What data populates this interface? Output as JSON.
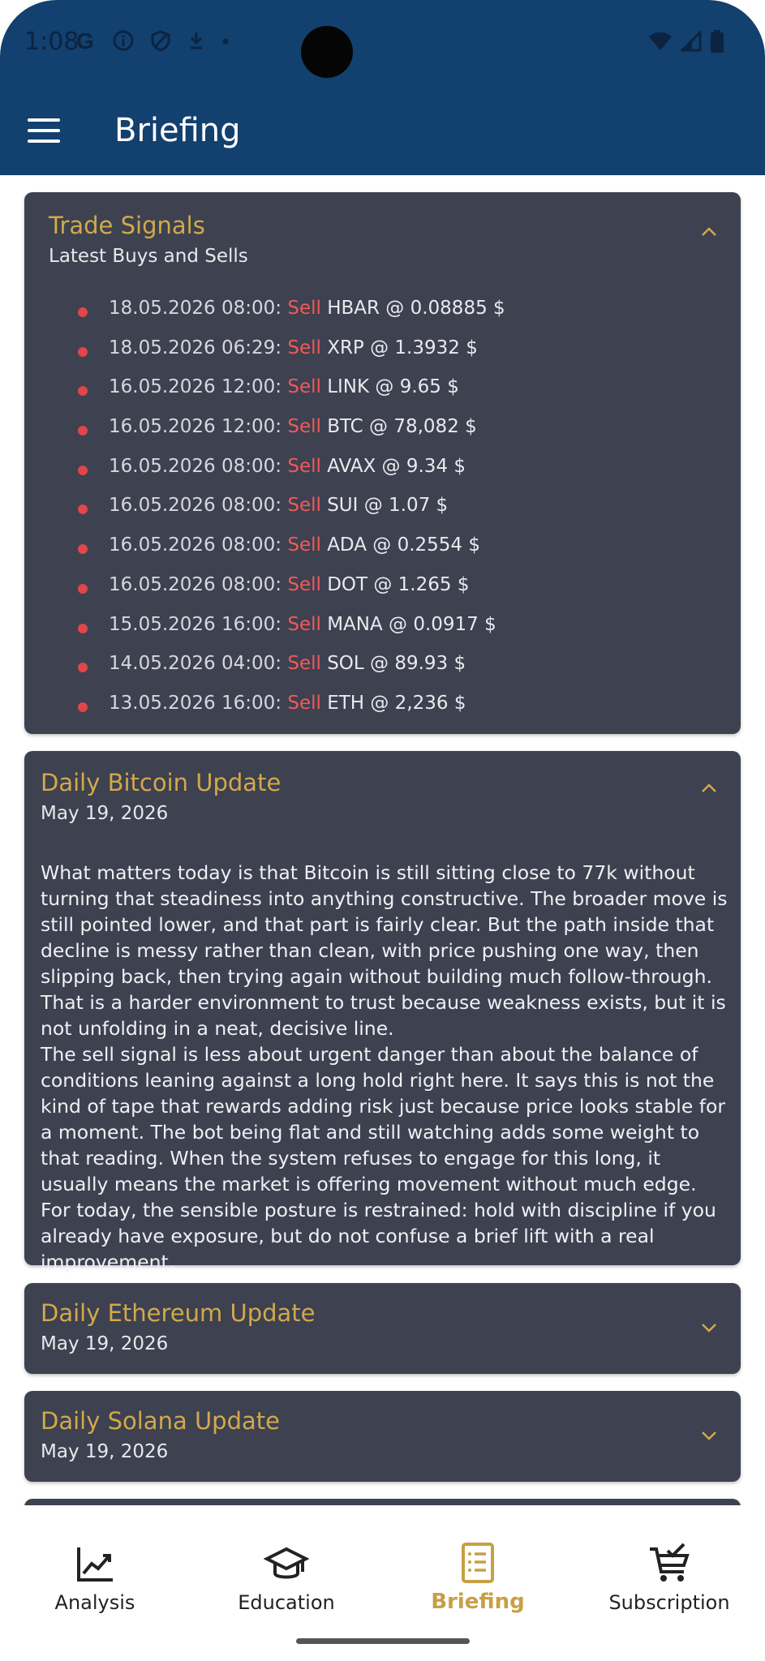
{
  "status_bar": {
    "time": "1:08",
    "icons_left": [
      "google-icon",
      "info-icon",
      "shield-icon",
      "download-icon",
      "dot-icon"
    ],
    "icons_right": [
      "wifi-icon",
      "signal-icon",
      "battery-icon"
    ]
  },
  "header": {
    "title": "Briefing"
  },
  "trade_signals": {
    "title": "Trade Signals",
    "subtitle": "Latest Buys and Sells",
    "expanded": true,
    "items": [
      {
        "datetime": "18.05.2026 08:00:",
        "action": "Sell",
        "detail": "HBAR @ 0.08885 $"
      },
      {
        "datetime": "18.05.2026 06:29:",
        "action": "Sell",
        "detail": "XRP @ 1.3932 $"
      },
      {
        "datetime": "16.05.2026 12:00:",
        "action": "Sell",
        "detail": "LINK @ 9.65 $"
      },
      {
        "datetime": "16.05.2026 12:00:",
        "action": "Sell",
        "detail": "BTC @ 78,082 $"
      },
      {
        "datetime": "16.05.2026 08:00:",
        "action": "Sell",
        "detail": "AVAX @ 9.34 $"
      },
      {
        "datetime": "16.05.2026 08:00:",
        "action": "Sell",
        "detail": "SUI @ 1.07 $"
      },
      {
        "datetime": "16.05.2026 08:00:",
        "action": "Sell",
        "detail": "ADA @ 0.2554 $"
      },
      {
        "datetime": "16.05.2026 08:00:",
        "action": "Sell",
        "detail": "DOT @ 1.265 $"
      },
      {
        "datetime": "15.05.2026 16:00:",
        "action": "Sell",
        "detail": "MANA @ 0.0917 $"
      },
      {
        "datetime": "14.05.2026 04:00:",
        "action": "Sell",
        "detail": "SOL @ 89.93 $"
      },
      {
        "datetime": "13.05.2026 16:00:",
        "action": "Sell",
        "detail": "ETH @ 2,236 $"
      }
    ]
  },
  "bitcoin_update": {
    "title": "Daily Bitcoin Update",
    "date": "May 19, 2026",
    "expanded": true,
    "paragraphs": [
      "What matters today is that Bitcoin is still sitting close to 77k without turning that steadiness into anything constructive. The broader move is still pointed lower, and that part is fairly clear. But the path inside that decline is messy rather than clean, with price pushing one way, then slipping back, then trying again without building much follow-through. That is a harder environment to trust because weakness exists, but it is not unfolding in a neat, decisive line.",
      "The sell signal is less about urgent danger than about the balance of conditions leaning against a long hold right here. It says this is not the kind of tape that rewards adding risk just because price looks stable for a moment. The bot being flat and still watching adds some weight to that reading. When the system refuses to engage for this long, it usually means the market is offering movement without much edge. For today, the sensible posture is restrained: hold with discipline if you already have exposure, but do not confuse a brief lift with a real improvement."
    ]
  },
  "ethereum_update": {
    "title": "Daily Ethereum Update",
    "date": "May 19, 2026",
    "expanded": false
  },
  "solana_update": {
    "title": "Daily Solana Update",
    "date": "May 19, 2026",
    "expanded": false
  },
  "bottom_nav": {
    "items": [
      {
        "label": "Analysis",
        "icon": "chart-line-icon",
        "active": false
      },
      {
        "label": "Education",
        "icon": "graduation-cap-icon",
        "active": false
      },
      {
        "label": "Briefing",
        "icon": "document-list-icon",
        "active": true
      },
      {
        "label": "Subscription",
        "icon": "cart-check-icon",
        "active": false
      }
    ]
  },
  "colors": {
    "header_bg": "#12406f",
    "card_bg": "#3d4150",
    "accent_gold": "#d2a94a",
    "sell_red": "#f05a57"
  }
}
